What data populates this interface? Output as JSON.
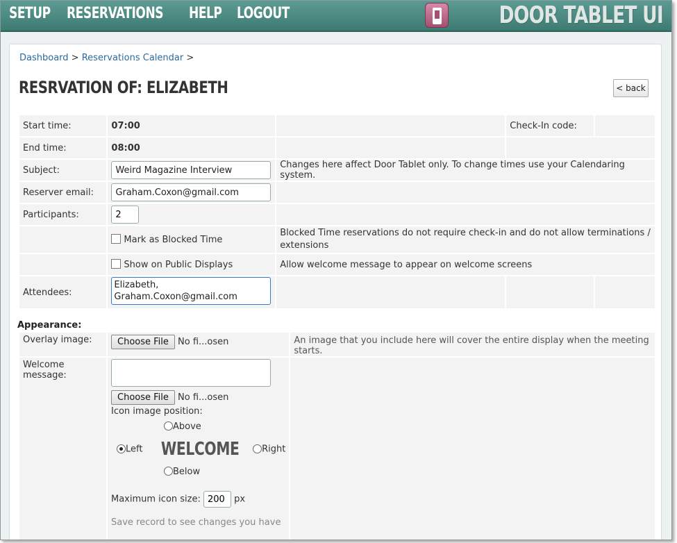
{
  "nav": {
    "items": [
      "SETUP",
      "RESERVATIONS",
      "HELP",
      "LOGOUT"
    ],
    "brand": "DOOR TABLET UI"
  },
  "breadcrumb": {
    "dashboard": "Dashboard",
    "sep1": ">",
    "calendar": "Reservations Calendar",
    "sep2": ">"
  },
  "page": {
    "title": "RESRVATION OF: ELIZABETH",
    "back_label": "< back"
  },
  "form": {
    "start_label": "Start time:",
    "start_value": "07:00",
    "checkin_label": "Check-In code:",
    "end_label": "End time:",
    "end_value": "08:00",
    "subject_label": "Subject:",
    "subject_value": "Weird Magazine Interview",
    "subject_note": "Changes here affect Door Tablet only.  To change times use your Calendaring system.",
    "email_label": "Reserver email:",
    "email_value": "Graham.Coxon@gmail.com",
    "participants_label": "Participants:",
    "participants_value": "2",
    "blocked_label": "Mark as Blocked Time",
    "blocked_note": "Blocked Time reservations do not require check-in and do not allow terminations / extensions",
    "public_label": "Show on Public Displays",
    "public_note": "Allow welcome message to appear on welcome screens",
    "attendees_label": "Attendees:",
    "attendees_value": "Elizabeth,\nGraham.Coxon@gmail.com"
  },
  "appearance": {
    "section_label": "Appearance:",
    "overlay_label": "Overlay image:",
    "choose_file": "Choose File",
    "no_file": "No fi...osen",
    "overlay_note": "An image that you include here will cover the entire display when the meeting starts.",
    "welcome_label": "Welcome message:",
    "icon_position_label": "Icon image position:",
    "above": "Above",
    "left": "Left",
    "welcome_preview": "WELCOME",
    "right": "Right",
    "below": "Below",
    "max_icon_label": "Maximum icon size:",
    "max_icon_value": "200",
    "px_label": "px",
    "save_note": "Save record to see changes you have"
  }
}
